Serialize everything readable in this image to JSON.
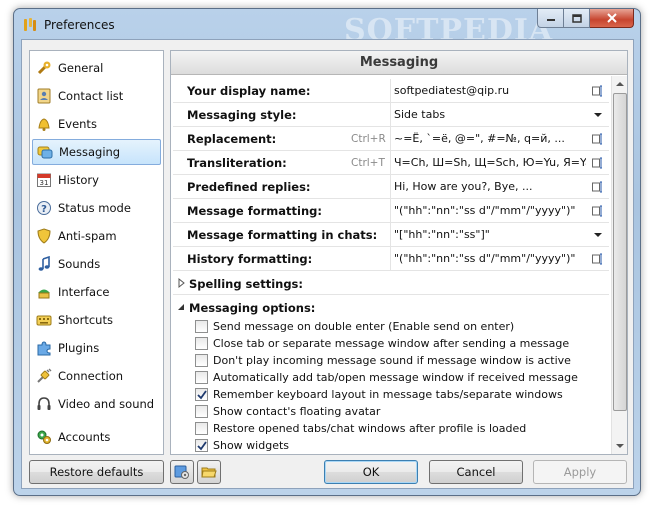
{
  "window": {
    "title": "Preferences",
    "watermark": "SOFTPEDIA"
  },
  "sidebar": {
    "items": [
      {
        "label": "General",
        "icon": "wrench-icon"
      },
      {
        "label": "Contact list",
        "icon": "contact-list-icon"
      },
      {
        "label": "Events",
        "icon": "bell-icon"
      },
      {
        "label": "Messaging",
        "icon": "messaging-icon",
        "selected": true
      },
      {
        "label": "History",
        "icon": "calendar-icon"
      },
      {
        "label": "Status mode",
        "icon": "status-question-icon"
      },
      {
        "label": "Anti-spam",
        "icon": "shield-icon"
      },
      {
        "label": "Sounds",
        "icon": "music-note-icon"
      },
      {
        "label": "Interface",
        "icon": "interface-icon"
      },
      {
        "label": "Shortcuts",
        "icon": "keyboard-icon"
      },
      {
        "label": "Plugins",
        "icon": "puzzle-icon"
      },
      {
        "label": "Connection",
        "icon": "plug-icon"
      },
      {
        "label": "Video and sound",
        "icon": "headset-icon"
      },
      {
        "label": "Accounts",
        "icon": "accounts-gear-icon"
      }
    ]
  },
  "panel": {
    "title": "Messaging",
    "settings": [
      {
        "name": "Your display name:",
        "hint": "",
        "value": "softpediatest@qip.ru",
        "control": "edit"
      },
      {
        "name": "Messaging style:",
        "hint": "",
        "value": "Side tabs",
        "control": "dropdown"
      },
      {
        "name": "Replacement:",
        "hint": "Ctrl+R",
        "value": "~=Ё, `=ё, @=\", #=№, q=й, ...",
        "control": "edit"
      },
      {
        "name": "Transliteration:",
        "hint": "Ctrl+T",
        "value": "Ч=Ch, Ш=Sh, Щ=Sch, Ю=Yu, Я=Ya, ...",
        "control": "edit"
      },
      {
        "name": "Predefined replies:",
        "hint": "",
        "value": "Hi, How are you?, Bye, ...",
        "control": "edit"
      },
      {
        "name": "Message formatting:",
        "hint": "",
        "value": "\"(\"hh\":\"nn\":\"ss d\"/\"mm\"/\"yyyy\")\"",
        "control": "edit"
      },
      {
        "name": "Message formatting in chats:",
        "hint": "",
        "value": "\"[\"hh\":\"nn\":\"ss\"]\"",
        "control": "dropdown"
      },
      {
        "name": "History formatting:",
        "hint": "",
        "value": "\"(\"hh\":\"nn\":\"ss d\"/\"mm\"/\"yyyy\")\"",
        "control": "edit"
      }
    ],
    "spelling_group": "Spelling settings:",
    "options_group": "Messaging options:",
    "options": [
      {
        "label": "Send message on double enter (Enable send on enter)",
        "checked": false
      },
      {
        "label": "Close tab or separate message window after sending a message",
        "checked": false
      },
      {
        "label": "Don't play incoming message sound if message window is active",
        "checked": false
      },
      {
        "label": "Automatically add tab/open message window if received message",
        "checked": false
      },
      {
        "label": "Remember keyboard layout in message tabs/separate windows",
        "checked": true
      },
      {
        "label": "Show contact's floating avatar",
        "checked": false
      },
      {
        "label": "Restore opened tabs/chat windows after profile is loaded",
        "checked": false
      },
      {
        "label": "Show widgets",
        "checked": true
      }
    ]
  },
  "buttons": {
    "restore_defaults": "Restore defaults",
    "ok": "OK",
    "cancel": "Cancel",
    "apply": "Apply"
  },
  "colors": {
    "selection": "#c7e4fb",
    "frame": "#b9d1ea",
    "close": "#c7452f"
  }
}
